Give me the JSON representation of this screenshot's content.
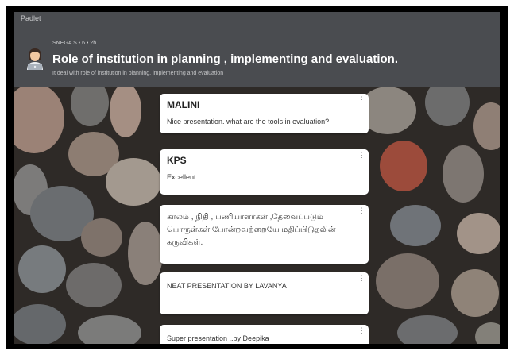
{
  "app": {
    "brand": "Padlet"
  },
  "header": {
    "meta": "SNEGA S  •  6  •  2h",
    "title": "Role of institution in planning , implementing and evaluation.",
    "subtitle": "It deal with role of institution in planning, implementing and evaluation"
  },
  "posts": [
    {
      "author": "MALINI",
      "body": "Nice presentation.  what are the tools in evaluation?"
    },
    {
      "author": "KPS",
      "body": "Excellent...."
    },
    {
      "author": "",
      "body": "காலம் , நிதி , பணியாளர்கள் ,தேவைப்படும் பொருள்கள் போன்றவற்றையே மதிப்பிடுதலின் கருவிகள்."
    },
    {
      "author": "",
      "body": "NEAT PRESENTATION BY LAVANYA"
    },
    {
      "author": "",
      "body": "Super presentation ..by Deepika"
    }
  ],
  "icons": {
    "avatar": "person-laptop-icon",
    "post_menu": "more-vertical-icon"
  },
  "colors": {
    "header_bg": "#4a4c50",
    "card_bg": "#ffffff",
    "frame": "#000000"
  }
}
